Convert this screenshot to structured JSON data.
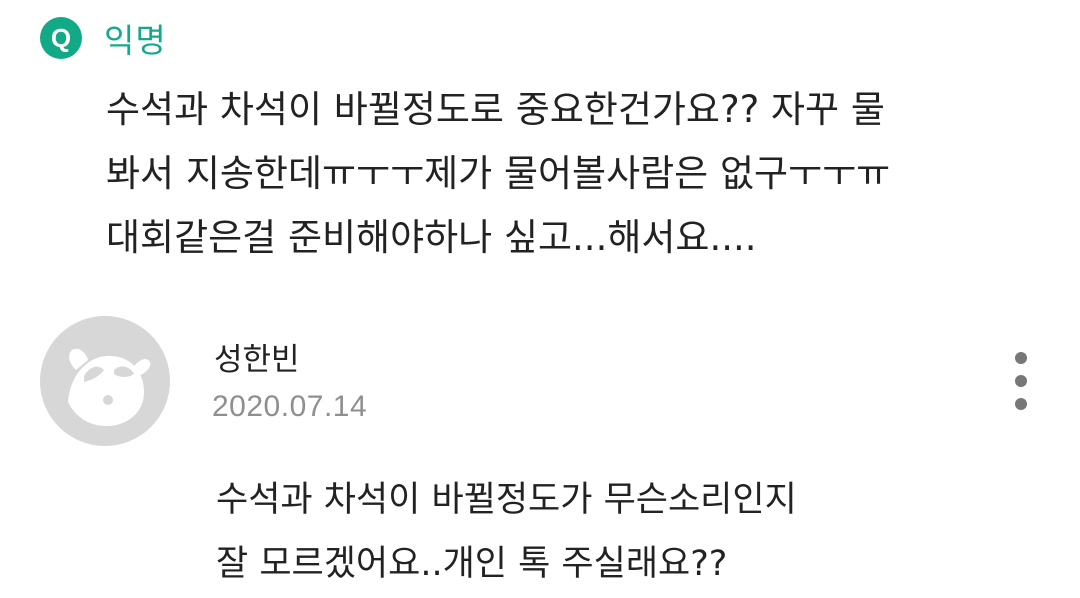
{
  "question": {
    "badge": "Q",
    "author": "익명",
    "text": "수석과 차석이 바뀔정도로 중요한건가요?? 자꾸 물\n봐서 지송한데ㅠㅜㅜ제가 물어볼사람은 없구ㅜㅜㅠ\n대회같은걸 준비해야하나 싶고...해서요...."
  },
  "answer": {
    "author": "성한빈",
    "date": "2020.07.14",
    "avatar_icon": "default-profile-avatar-icon",
    "more_icon": "more-vertical-icon",
    "text": "수석과 차석이 바뀔정도가 무슨소리인지\n잘 모르겠어요..개인 톡 주실래요??"
  },
  "colors": {
    "accent": "#12a987",
    "avatar_bg": "#d7d7d7",
    "date": "#8f8f8f",
    "text": "#222222"
  }
}
